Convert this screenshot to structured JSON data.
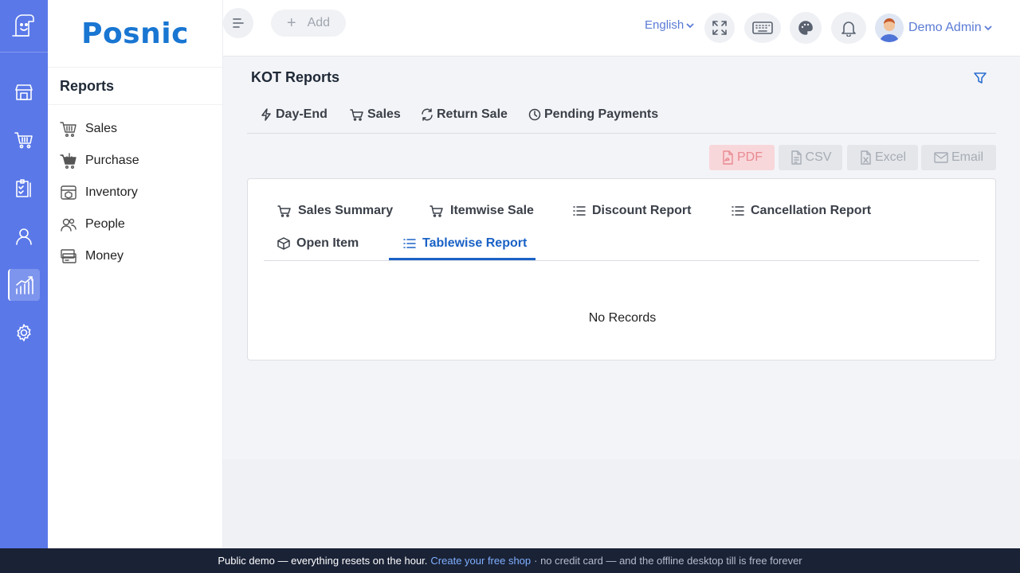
{
  "brand": {
    "name": "Posnic"
  },
  "sidebar": {
    "title": "Reports",
    "items": [
      {
        "label": "Sales",
        "icon": "basket-icon"
      },
      {
        "label": "Purchase",
        "icon": "cart-icon"
      },
      {
        "label": "Inventory",
        "icon": "inventory-icon"
      },
      {
        "label": "People",
        "icon": "people-icon"
      },
      {
        "label": "Money",
        "icon": "money-icon"
      }
    ]
  },
  "header": {
    "add_label": "Add",
    "language": "English",
    "user_name": "Demo Admin"
  },
  "page": {
    "title": "KOT Reports",
    "top_tabs": [
      {
        "label": "Day-End",
        "icon": "lightning-icon"
      },
      {
        "label": "Sales",
        "icon": "cart-icon"
      },
      {
        "label": "Return Sale",
        "icon": "refresh-icon"
      },
      {
        "label": "Pending Payments",
        "icon": "clock-icon"
      }
    ],
    "exports": {
      "pdf": "PDF",
      "csv": "CSV",
      "excel": "Excel",
      "email": "Email"
    },
    "report_tabs": [
      {
        "label": "Sales Summary",
        "icon": "cart-icon"
      },
      {
        "label": "Itemwise Sale",
        "icon": "cart-icon"
      },
      {
        "label": "Discount Report",
        "icon": "list-icon"
      },
      {
        "label": "Cancellation Report",
        "icon": "list-icon"
      },
      {
        "label": "Open Item",
        "icon": "box-icon"
      },
      {
        "label": "Tablewise Report",
        "icon": "list-icon",
        "active": true
      }
    ],
    "empty_message": "No Records"
  },
  "banner": {
    "text": "Public demo — everything resets on the hour.",
    "link": "Create your free shop",
    "rest": "· no credit card — and the offline desktop till is free forever"
  },
  "colors": {
    "rail": "#5a78e8",
    "brand": "#1976d2",
    "active_tab": "#1a62c6",
    "banner_bg": "#1a2236"
  }
}
